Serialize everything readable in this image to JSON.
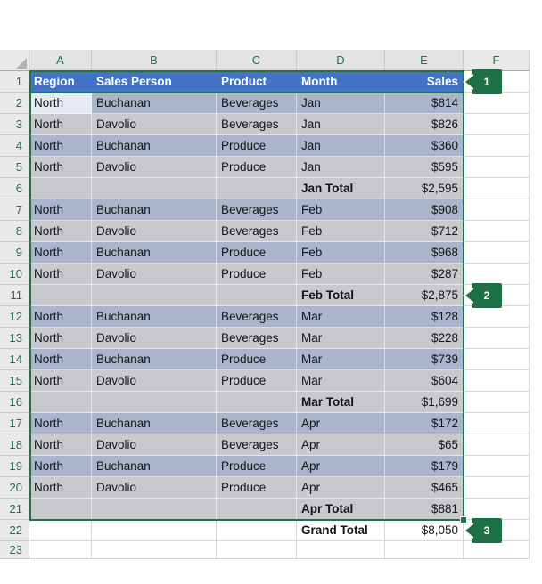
{
  "sheet": {
    "column_headers": [
      "A",
      "B",
      "C",
      "D",
      "E",
      "F"
    ],
    "selected_columns": [
      "A",
      "B",
      "C",
      "D",
      "E"
    ],
    "visible_rows": [
      "1",
      "2",
      "3",
      "4",
      "5",
      "6",
      "7",
      "8",
      "9",
      "10",
      "11",
      "12",
      "13",
      "14",
      "15",
      "16",
      "17",
      "18",
      "19",
      "20",
      "21",
      "22",
      "23"
    ]
  },
  "table": {
    "header_row": {
      "num": "1",
      "cells": [
        "Region",
        "Sales Person",
        "Product",
        "Month",
        "Sales"
      ]
    },
    "rows": [
      {
        "num": "2",
        "cells": [
          "North",
          "Buchanan",
          "Beverages",
          "Jan",
          "$814"
        ],
        "band": "dark",
        "active_cell": true,
        "total": false
      },
      {
        "num": "3",
        "cells": [
          "North",
          "Davolio",
          "Beverages",
          "Jan",
          "$826"
        ],
        "band": "light",
        "active_cell": false,
        "total": false
      },
      {
        "num": "4",
        "cells": [
          "North",
          "Buchanan",
          "Produce",
          "Jan",
          "$360"
        ],
        "band": "dark",
        "active_cell": false,
        "total": false
      },
      {
        "num": "5",
        "cells": [
          "North",
          "Davolio",
          "Produce",
          "Jan",
          "$595"
        ],
        "band": "light",
        "active_cell": false,
        "total": false
      },
      {
        "num": "6",
        "cells": [
          "",
          "",
          "",
          "Jan Total",
          "$2,595"
        ],
        "band": "light",
        "active_cell": false,
        "total": true
      },
      {
        "num": "7",
        "cells": [
          "North",
          "Buchanan",
          "Beverages",
          "Feb",
          "$908"
        ],
        "band": "dark",
        "active_cell": false,
        "total": false
      },
      {
        "num": "8",
        "cells": [
          "North",
          "Davolio",
          "Beverages",
          "Feb",
          "$712"
        ],
        "band": "light",
        "active_cell": false,
        "total": false
      },
      {
        "num": "9",
        "cells": [
          "North",
          "Buchanan",
          "Produce",
          "Feb",
          "$968"
        ],
        "band": "dark",
        "active_cell": false,
        "total": false
      },
      {
        "num": "10",
        "cells": [
          "North",
          "Davolio",
          "Produce",
          "Feb",
          "$287"
        ],
        "band": "light",
        "active_cell": false,
        "total": false
      },
      {
        "num": "11",
        "cells": [
          "",
          "",
          "",
          "Feb Total",
          "$2,875"
        ],
        "band": "light",
        "active_cell": false,
        "total": true
      },
      {
        "num": "12",
        "cells": [
          "North",
          "Buchanan",
          "Beverages",
          "Mar",
          "$128"
        ],
        "band": "dark",
        "active_cell": false,
        "total": false
      },
      {
        "num": "13",
        "cells": [
          "North",
          "Davolio",
          "Beverages",
          "Mar",
          "$228"
        ],
        "band": "light",
        "active_cell": false,
        "total": false
      },
      {
        "num": "14",
        "cells": [
          "North",
          "Buchanan",
          "Produce",
          "Mar",
          "$739"
        ],
        "band": "dark",
        "active_cell": false,
        "total": false
      },
      {
        "num": "15",
        "cells": [
          "North",
          "Davolio",
          "Produce",
          "Mar",
          "$604"
        ],
        "band": "light",
        "active_cell": false,
        "total": false
      },
      {
        "num": "16",
        "cells": [
          "",
          "",
          "",
          "Mar Total",
          "$1,699"
        ],
        "band": "light",
        "active_cell": false,
        "total": true
      },
      {
        "num": "17",
        "cells": [
          "North",
          "Buchanan",
          "Beverages",
          "Apr",
          "$172"
        ],
        "band": "dark",
        "active_cell": false,
        "total": false
      },
      {
        "num": "18",
        "cells": [
          "North",
          "Davolio",
          "Beverages",
          "Apr",
          "$65"
        ],
        "band": "light",
        "active_cell": false,
        "total": false
      },
      {
        "num": "19",
        "cells": [
          "North",
          "Buchanan",
          "Produce",
          "Apr",
          "$179"
        ],
        "band": "dark",
        "active_cell": false,
        "total": false
      },
      {
        "num": "20",
        "cells": [
          "North",
          "Davolio",
          "Produce",
          "Apr",
          "$465"
        ],
        "band": "light",
        "active_cell": false,
        "total": false
      },
      {
        "num": "21",
        "cells": [
          "",
          "",
          "",
          "Apr Total",
          "$881"
        ],
        "band": "light",
        "active_cell": false,
        "total": true
      },
      {
        "num": "22",
        "cells": [
          "",
          "",
          "",
          "Grand Total",
          "$8,050"
        ],
        "band": "none",
        "active_cell": false,
        "total": true
      },
      {
        "num": "23",
        "cells": [
          "",
          "",
          "",
          "",
          ""
        ],
        "band": "none",
        "active_cell": false,
        "total": false,
        "clipped": true
      }
    ]
  },
  "badges": [
    {
      "label": "1",
      "points_at_row": "1"
    },
    {
      "label": "2",
      "points_at_row": "11"
    },
    {
      "label": "3",
      "points_at_row": "22"
    }
  ],
  "colors": {
    "header_fill": "#4472C4",
    "header_text": "#FFFFFF",
    "band_dark": "#AAB4CB",
    "band_light": "#C8C8CD",
    "active_cell": "#E6EAF3",
    "selection_green": "#217346",
    "badge_green": "#1E7145",
    "heading_text_green": "#217346"
  }
}
